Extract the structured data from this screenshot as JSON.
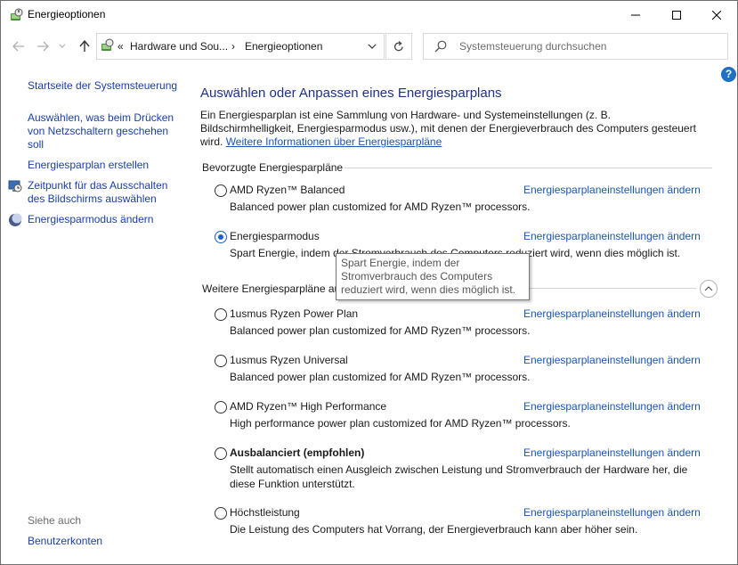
{
  "window": {
    "title": "Energieoptionen"
  },
  "address": {
    "crumb_prefix": "«",
    "crumb1": "Hardware und Sou...",
    "separator": "›",
    "crumb2": "Energieoptionen",
    "search_placeholder": "Systemsteuerung durchsuchen"
  },
  "help": {
    "label": "?"
  },
  "sidebar": {
    "home": "Startseite der Systemsteuerung",
    "links": [
      "Auswählen, was beim Drücken von Netzschaltern geschehen soll",
      "Energiesparplan erstellen",
      "Zeitpunkt für das Ausschalten des Bildschirms auswählen",
      "Energiesparmodus ändern"
    ],
    "see_also": "Siehe auch",
    "user_accounts": "Benutzerkonten"
  },
  "main": {
    "heading": "Auswählen oder Anpassen eines Energiesparplans",
    "intro": "Ein Energiesparplan ist eine Sammlung von Hardware- und Systemeinstellungen (z. B. Bildschirmhelligkeit, Energiesparmodus usw.), mit denen der Energieverbrauch des Computers gesteuert wird.",
    "intro_link": "Weitere Informationen über Energiesparpläne",
    "preferred_heading": "Bevorzugte Energiesparpläne",
    "more_heading": "Weitere Energiesparpläne au",
    "change_link": "Energiesparplaneinstellungen ändern",
    "preferred_plans": [
      {
        "name": "AMD Ryzen™ Balanced",
        "desc": "Balanced power plan customized for AMD Ryzen™ processors.",
        "selected": false
      },
      {
        "name": "Energiesparmodus",
        "desc": "Spart Energie, indem der Stromverbrauch des Computers reduziert wird, wenn dies möglich ist.",
        "selected": true
      }
    ],
    "more_plans": [
      {
        "name": "1usmus Ryzen Power Plan",
        "desc": "Balanced power plan customized for AMD Ryzen™ processors."
      },
      {
        "name": "1usmus Ryzen Universal",
        "desc": "Balanced power plan customized for AMD Ryzen™ processors."
      },
      {
        "name": "AMD Ryzen™ High Performance",
        "desc": "High performance power plan customized for AMD Ryzen™ processors."
      },
      {
        "name": "Ausbalanciert (empfohlen)",
        "desc": "Stellt automatisch einen Ausgleich zwischen Leistung und Stromverbrauch der Hardware her, die diese Funktion unterstützt."
      },
      {
        "name": "Höchstleistung",
        "desc": "Die Leistung des Computers hat Vorrang, der Energieverbrauch kann aber höher sein."
      }
    ],
    "tooltip": "Spart Energie, indem der Stromverbrauch des Computers reduziert wird, wenn dies möglich ist."
  },
  "colors": {
    "link": "#1a56b8",
    "heading": "#1e3287",
    "radio_selected": "#1a5fd6"
  },
  "icons": [
    "power-options-icon",
    "back-arrow-icon",
    "forward-arrow-icon",
    "recent-dropdown-icon",
    "up-arrow-icon",
    "chevron-down-icon",
    "refresh-icon",
    "search-icon",
    "help-icon",
    "minimize-icon",
    "maximize-icon",
    "close-icon",
    "display-clock-icon",
    "moon-icon",
    "collapse-icon"
  ]
}
